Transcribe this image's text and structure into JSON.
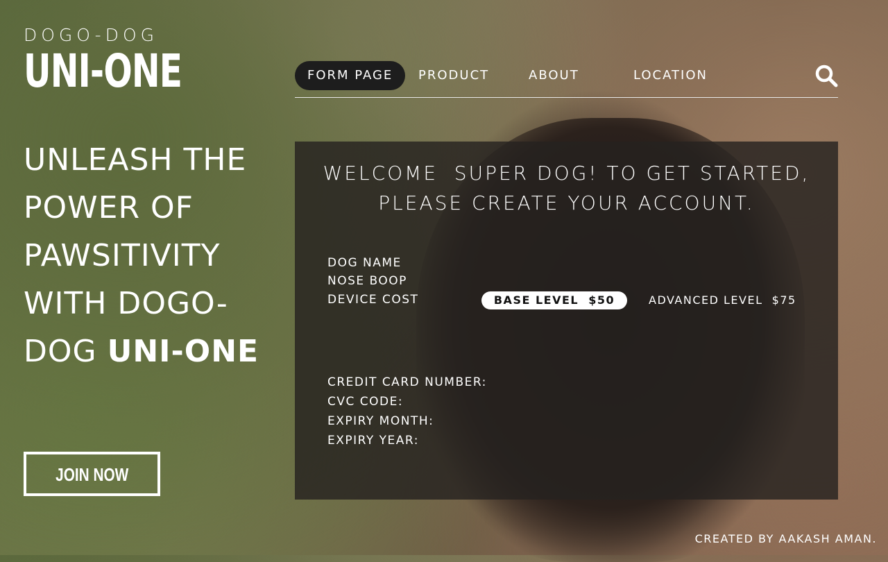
{
  "brand": {
    "top": "DOGO-DOG",
    "main": "UNI-ONE"
  },
  "nav": {
    "items": [
      {
        "label": "FORM PAGE",
        "active": true
      },
      {
        "label": "PRODUCT"
      },
      {
        "label": "ABOUT"
      },
      {
        "label": "LOCATION"
      }
    ],
    "search_icon": "search-icon"
  },
  "hero": {
    "line_part": "UNLEASH THE POWER OF PAWSITIVITY WITH DOGO-DOG",
    "bold_part": "UNI-ONE"
  },
  "join_button": "JOIN NOW",
  "form": {
    "title_line1": "WELCOME  SUPER DOG! TO GET STARTED,",
    "title_line2": "PLEASE CREATE YOUR ACCOUNT.",
    "dog_name": "DOG NAME",
    "nose_boop": "NOSE BOOP",
    "device_cost": "DEVICE COST",
    "base_level": "BASE LEVEL  $50",
    "advanced_level": "ADVANCED LEVEL  $75",
    "credit_card": "CREDIT CARD NUMBER:",
    "cvc": "CVC CODE:",
    "expiry_month": "EXPIRY MONTH:",
    "expiry_year": "EXPIRY YEAR:"
  },
  "footer": {
    "credit": "CREATED BY AAKASH AMAN."
  }
}
